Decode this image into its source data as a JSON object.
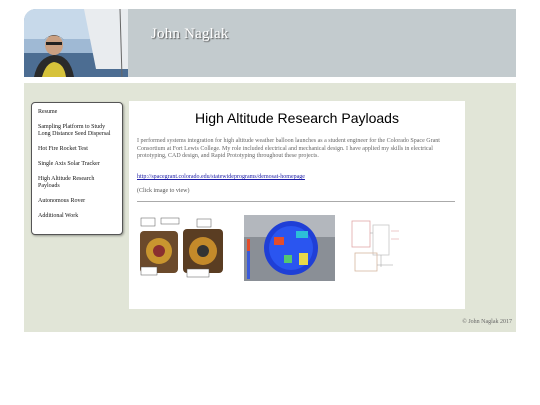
{
  "header": {
    "title": "John Naglak",
    "photo_icon": "sailing-portrait-photo"
  },
  "sidebar": {
    "items": [
      {
        "label": "Resume"
      },
      {
        "label": "Sampling Platform to Study Long Distance Seed Dispersal"
      },
      {
        "label": "Hot Fire Rocket Test"
      },
      {
        "label": "Single Axis Solar Tracker"
      },
      {
        "label": "High Altitude Research Payloads"
      },
      {
        "label": "Autonomous Rover"
      },
      {
        "label": "Additional Work"
      }
    ]
  },
  "main": {
    "title": "High Altitude Research Payloads",
    "description": "I performed systems integration for high altitude weather balloon launches as a student engineer for the Colorado Space Grant Consortium at Fort Lewis College. My role included electrical and mechanical design. I have applied my skills in electrical prototyping, CAD design, and Rapid Prototyping throughout these projects.",
    "link": "http://spacegrant.colorado.edu/statewideprograms/demosat-homepage",
    "hint": "(Click image to view)",
    "thumbnails": [
      {
        "icon": "payload-photo-thumbnail"
      },
      {
        "icon": "cad-render-thumbnail"
      },
      {
        "icon": "schematic-thumbnail"
      }
    ]
  },
  "footer": {
    "copyright": "© John Naglak 2017"
  },
  "colors": {
    "header_bg": "#c3cbce",
    "page_bg": "#e1e5d7",
    "link": "#1a1aa6"
  }
}
